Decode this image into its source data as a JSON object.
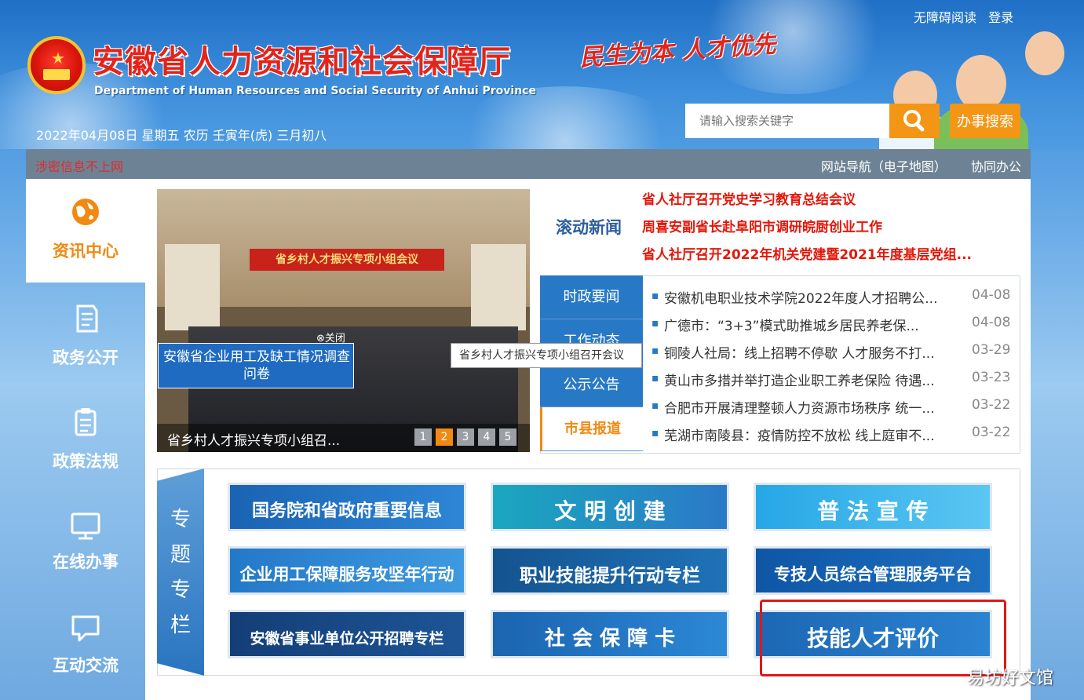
{
  "header": {
    "title": "安徽省人力资源和社会保障厅",
    "subtitle": "Department of Human Resources and Social Security of Anhui Province",
    "slogan": "民生为本 人才优先",
    "date": "2022年04月08日 星期五 农历 壬寅年(虎) 三月初八",
    "top_links": [
      "无障碍阅读",
      "登录"
    ],
    "search_placeholder": "请输入搜索关键字",
    "affairs_search_label": "办事搜索"
  },
  "info_bar": {
    "secret_note": "涉密信息不上网",
    "links": [
      "网站导航（电子地图）",
      "协同办公"
    ]
  },
  "left_nav": [
    {
      "label": "资讯中心",
      "icon": "globe-icon",
      "active": true
    },
    {
      "label": "政务公开",
      "icon": "document-icon",
      "active": false
    },
    {
      "label": "政策法规",
      "icon": "clipboard-icon",
      "active": false
    },
    {
      "label": "在线办事",
      "icon": "monitor-icon",
      "active": false
    },
    {
      "label": "互动交流",
      "icon": "chat-icon",
      "active": false
    }
  ],
  "slider": {
    "banner_text": "省乡村人才振兴专项小组会议",
    "caption": "省乡村人才振兴专项小组召...",
    "dots": [
      "1",
      "2",
      "3",
      "4",
      "5"
    ],
    "active_dot": 1,
    "survey_close": "⊗关闭",
    "survey_text": "安徽省企业用工及缺工情况调查问卷",
    "tooltip": "省乡村人才振兴专项小组召开会议"
  },
  "scroll_news": {
    "label": "滚动新闻",
    "items": [
      "省人社厅召开党史学习教育总结会议",
      "周喜安副省长赴阜阳市调研皖厨创业工作",
      "省人社厅召开2022年机关党建暨2021年度基层党组..."
    ]
  },
  "news_tabs": [
    {
      "label": "时政要闻",
      "active": false
    },
    {
      "label": "工作动态",
      "active": false
    },
    {
      "label": "公示公告",
      "active": false
    },
    {
      "label": "市县报道",
      "active": true
    }
  ],
  "news_list": [
    {
      "title": "安徽机电职业技术学院2022年度人才招聘公...",
      "date": "04-08"
    },
    {
      "title": "广德市：“3+3”模式助推城乡居民养老保...",
      "date": "04-08"
    },
    {
      "title": "铜陵人社局：线上招聘不停歇 人才服务不打...",
      "date": "03-29"
    },
    {
      "title": "黄山市多措并举打造企业职工养老保险 待遇...",
      "date": "03-23"
    },
    {
      "title": "合肥市开展清理整顿人力资源市场秩序 统一...",
      "date": "03-22"
    },
    {
      "title": "芜湖市南陵县：疫情防控不放松 线上庭审不...",
      "date": "03-22"
    }
  ],
  "topics": {
    "label": [
      "专",
      "题",
      "专",
      "栏"
    ],
    "items": [
      "国务院和省政府重要信息",
      "文 明 创 建",
      "普 法 宣 传",
      "企业用工保障服务攻坚年行动",
      "职业技能提升行动专栏",
      "专技人员综合管理服务平台",
      "安徽省事业单位公开招聘专栏",
      "社 会 保 障 卡",
      "技能人才评价"
    ]
  },
  "watermark": "易坊好文馆"
}
